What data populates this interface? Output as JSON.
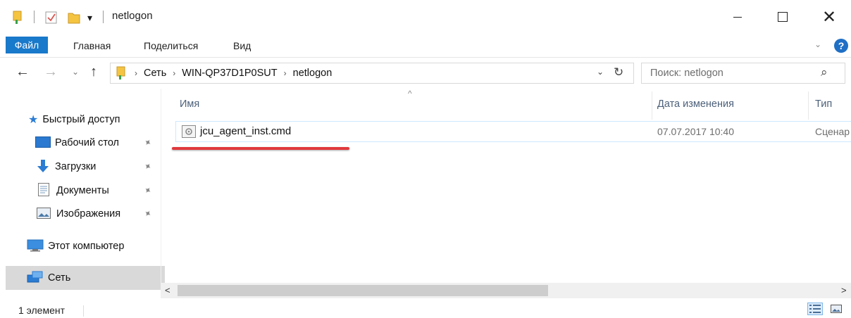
{
  "titlebar": {
    "title": "netlogon",
    "qa_dropdown_glyph": "▾",
    "minimize_glyph": "",
    "close_glyph": "✕"
  },
  "ribbon": {
    "tabs": [
      "Файл",
      "Главная",
      "Поделиться",
      "Вид"
    ],
    "expand_glyph": "⌄",
    "help_label": "?"
  },
  "address": {
    "back_glyph": "←",
    "forward_glyph": "→",
    "recent_glyph": "⌄",
    "up_glyph": "↑",
    "crumbs": [
      "Сеть",
      "WIN-QP37D1P0SUT",
      "netlogon"
    ],
    "separator_glyph": "›",
    "dropdown_glyph": "⌄",
    "refresh_glyph": "↻"
  },
  "search": {
    "placeholder": "Поиск: netlogon",
    "icon_glyph": "⌕"
  },
  "navpane": {
    "quick_access": "Быстрый доступ",
    "pinned": [
      "Рабочий стол",
      "Загрузки",
      "Документы",
      "Изображения"
    ],
    "pin_glyph": "📌",
    "this_pc": "Этот компьютер",
    "network": "Сеть"
  },
  "filelist": {
    "columns": {
      "name": "Имя",
      "date": "Дата изменения",
      "type": "Тип"
    },
    "sort_glyph": "^",
    "rows": [
      {
        "name": "jcu_agent_inst.cmd",
        "date": "07.07.2017 10:40",
        "type": "Сценар"
      }
    ]
  },
  "hscroll": {
    "left_glyph": "<",
    "right_glyph": ">",
    "position": 0.53
  },
  "status": {
    "count": "1 элемент"
  },
  "colors": {
    "file_tab": "#1979ca",
    "selection_border": "#cde8ff",
    "annotation_red": "#e0393e",
    "nav_selected": "#d9d9d9"
  },
  "icons": {
    "folder": "folder-icon",
    "desktop": "desktop-icon",
    "downloads": "download-arrow-icon",
    "documents": "documents-icon",
    "pictures": "pictures-icon",
    "pc": "monitor-icon",
    "network": "network-icon",
    "star": "star-icon",
    "cmd_file": "cmd-file-icon"
  }
}
